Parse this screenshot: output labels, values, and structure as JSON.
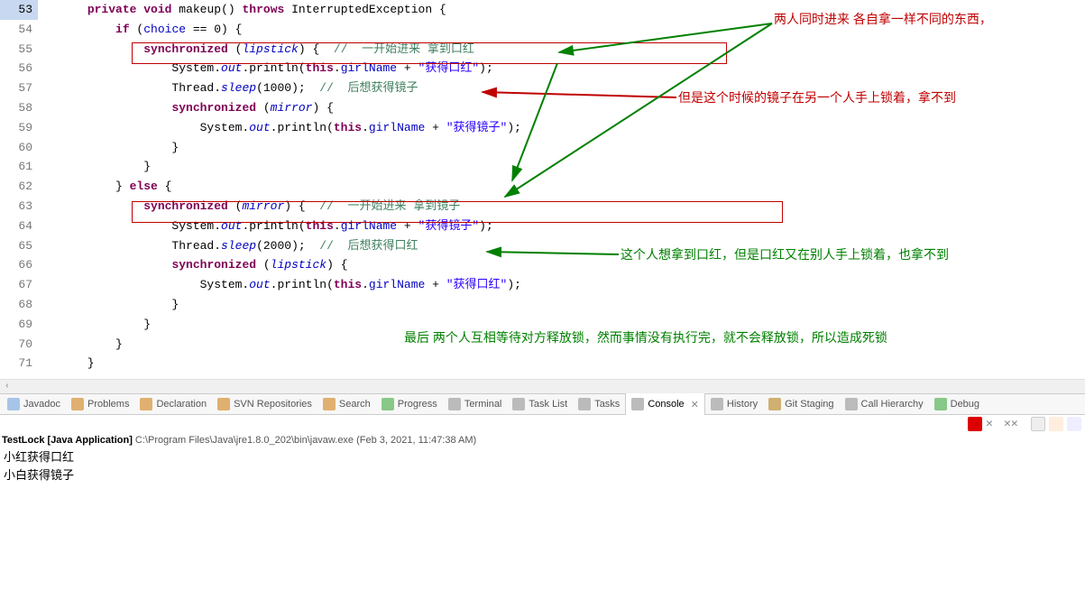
{
  "lines": [
    {
      "n": 53,
      "hl": true,
      "tokens": [
        [
          "plain",
          "      "
        ],
        [
          "kw",
          "private"
        ],
        [
          "plain",
          " "
        ],
        [
          "kw",
          "void"
        ],
        [
          "plain",
          " "
        ],
        [
          "method",
          "makeup"
        ],
        [
          "plain",
          "() "
        ],
        [
          "kw",
          "throws"
        ],
        [
          "plain",
          " "
        ],
        [
          "classname",
          "InterruptedException"
        ],
        [
          "plain",
          " {"
        ]
      ]
    },
    {
      "n": 54,
      "tokens": [
        [
          "plain",
          "          "
        ],
        [
          "kw",
          "if"
        ],
        [
          "plain",
          " ("
        ],
        [
          "field",
          "choice"
        ],
        [
          "plain",
          " == 0) {"
        ]
      ]
    },
    {
      "n": 55,
      "tokens": [
        [
          "plain",
          "              "
        ],
        [
          "kw",
          "synchronized"
        ],
        [
          "plain",
          " ("
        ],
        [
          "static",
          "lipstick"
        ],
        [
          "plain",
          ") {  "
        ],
        [
          "comment",
          "//"
        ],
        [
          "plain",
          "  "
        ],
        [
          "comment-cn",
          "一开始进来 拿到口红"
        ]
      ]
    },
    {
      "n": 56,
      "tokens": [
        [
          "plain",
          "                  System."
        ],
        [
          "static",
          "out"
        ],
        [
          "plain",
          ".println("
        ],
        [
          "kw",
          "this"
        ],
        [
          "plain",
          "."
        ],
        [
          "field",
          "girlName"
        ],
        [
          "plain",
          " + "
        ],
        [
          "str",
          "\"获得口红\""
        ],
        [
          "plain",
          ");"
        ]
      ]
    },
    {
      "n": 57,
      "tokens": [
        [
          "plain",
          "                  Thread."
        ],
        [
          "static",
          "sleep"
        ],
        [
          "plain",
          "(1000);  "
        ],
        [
          "comment",
          "//"
        ],
        [
          "plain",
          "  "
        ],
        [
          "comment-cn",
          "后想获得镜子"
        ]
      ]
    },
    {
      "n": 58,
      "tokens": [
        [
          "plain",
          "                  "
        ],
        [
          "kw",
          "synchronized"
        ],
        [
          "plain",
          " ("
        ],
        [
          "static",
          "mirror"
        ],
        [
          "plain",
          ") {"
        ]
      ]
    },
    {
      "n": 59,
      "tokens": [
        [
          "plain",
          "                      System."
        ],
        [
          "static",
          "out"
        ],
        [
          "plain",
          ".println("
        ],
        [
          "kw",
          "this"
        ],
        [
          "plain",
          "."
        ],
        [
          "field",
          "girlName"
        ],
        [
          "plain",
          " + "
        ],
        [
          "str",
          "\"获得镜子\""
        ],
        [
          "plain",
          ");"
        ]
      ]
    },
    {
      "n": 60,
      "tokens": [
        [
          "plain",
          "                  }"
        ]
      ]
    },
    {
      "n": 61,
      "tokens": [
        [
          "plain",
          "              }"
        ]
      ]
    },
    {
      "n": 62,
      "tokens": [
        [
          "plain",
          "          } "
        ],
        [
          "kw",
          "else"
        ],
        [
          "plain",
          " {"
        ]
      ]
    },
    {
      "n": 63,
      "tokens": [
        [
          "plain",
          "              "
        ],
        [
          "kw",
          "synchronized"
        ],
        [
          "plain",
          " ("
        ],
        [
          "static",
          "mirror"
        ],
        [
          "plain",
          ") {  "
        ],
        [
          "comment",
          "//"
        ],
        [
          "plain",
          "  "
        ],
        [
          "comment-cn",
          "一开始进来 拿到镜子"
        ]
      ]
    },
    {
      "n": 64,
      "tokens": [
        [
          "plain",
          "                  System."
        ],
        [
          "static",
          "out"
        ],
        [
          "plain",
          ".println("
        ],
        [
          "kw",
          "this"
        ],
        [
          "plain",
          "."
        ],
        [
          "field",
          "girlName"
        ],
        [
          "plain",
          " + "
        ],
        [
          "str",
          "\"获得镜子\""
        ],
        [
          "plain",
          ");"
        ]
      ]
    },
    {
      "n": 65,
      "tokens": [
        [
          "plain",
          "                  Thread."
        ],
        [
          "static",
          "sleep"
        ],
        [
          "plain",
          "(2000);  "
        ],
        [
          "comment",
          "//"
        ],
        [
          "plain",
          "  "
        ],
        [
          "comment-cn",
          "后想获得口红"
        ]
      ]
    },
    {
      "n": 66,
      "tokens": [
        [
          "plain",
          "                  "
        ],
        [
          "kw",
          "synchronized"
        ],
        [
          "plain",
          " ("
        ],
        [
          "static",
          "lipstick"
        ],
        [
          "plain",
          ") {"
        ]
      ]
    },
    {
      "n": 67,
      "tokens": [
        [
          "plain",
          "                      System."
        ],
        [
          "static",
          "out"
        ],
        [
          "plain",
          ".println("
        ],
        [
          "kw",
          "this"
        ],
        [
          "plain",
          "."
        ],
        [
          "field",
          "girlName"
        ],
        [
          "plain",
          " + "
        ],
        [
          "str",
          "\"获得口红\""
        ],
        [
          "plain",
          ");"
        ]
      ]
    },
    {
      "n": 68,
      "tokens": [
        [
          "plain",
          "                  }"
        ]
      ]
    },
    {
      "n": 69,
      "tokens": [
        [
          "plain",
          "              }"
        ]
      ]
    },
    {
      "n": 70,
      "tokens": [
        [
          "plain",
          "          }"
        ]
      ]
    },
    {
      "n": 71,
      "tokens": [
        [
          "plain",
          "      }"
        ]
      ]
    }
  ],
  "annotations": {
    "a1": "两人同时进来  各自拿一样不同的东西，",
    "a2": "但是这个时候的镜子在另一个人手上锁着，拿不到",
    "a3": "这个人想拿到口红，但是口红又在别人手上锁着，也拿不到",
    "a4": "最后 两个人互相等待对方释放锁，然而事情没有执行完，就不会释放锁，所以造成死锁"
  },
  "tabs": [
    {
      "id": "javadoc",
      "label": "Javadoc",
      "icon": "#a6c4e8"
    },
    {
      "id": "problems",
      "label": "Problems",
      "icon": "#e0b070"
    },
    {
      "id": "declaration",
      "label": "Declaration",
      "icon": "#e0b070"
    },
    {
      "id": "svn",
      "label": "SVN Repositories",
      "icon": "#e0b070"
    },
    {
      "id": "search",
      "label": "Search",
      "icon": "#e0b070"
    },
    {
      "id": "progress",
      "label": "Progress",
      "icon": "#88c888"
    },
    {
      "id": "terminal",
      "label": "Terminal",
      "icon": "#bbb"
    },
    {
      "id": "tasklist",
      "label": "Task List",
      "icon": "#bbb"
    },
    {
      "id": "tasks",
      "label": "Tasks",
      "icon": "#bbb"
    },
    {
      "id": "console",
      "label": "Console",
      "icon": "#bbb",
      "active": true
    },
    {
      "id": "history",
      "label": "History",
      "icon": "#bbb"
    },
    {
      "id": "gitstaging",
      "label": "Git Staging",
      "icon": "#d0b070"
    },
    {
      "id": "callhierarchy",
      "label": "Call Hierarchy",
      "icon": "#bbb"
    },
    {
      "id": "debug",
      "label": "Debug",
      "icon": "#88c888"
    }
  ],
  "toolbar": {
    "stop": "■",
    "remove": "✕",
    "gear": "⚙",
    "clear": "▭",
    "scroll": "⤓",
    "pin": "📌"
  },
  "console": {
    "title_bold": "TestLock [Java Application]",
    "title_rest": " C:\\Program Files\\Java\\jre1.8.0_202\\bin\\javaw.exe (Feb 3, 2021, 11:47:38 AM)",
    "out": [
      "小红获得口红",
      "小白获得镜子"
    ]
  }
}
